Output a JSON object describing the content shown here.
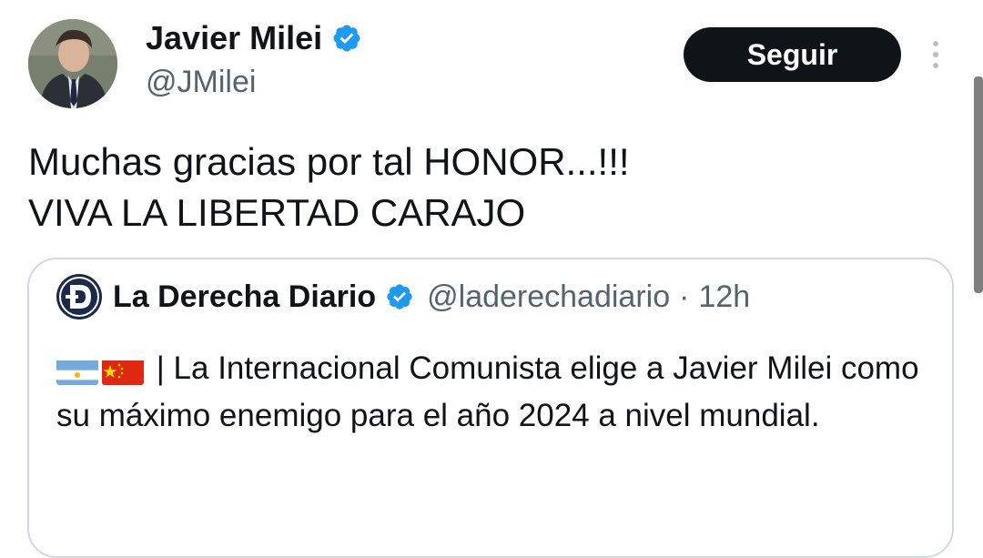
{
  "author": {
    "name": "Javier Milei",
    "handle": "@JMilei",
    "verified_color": "#1d9bf0"
  },
  "actions": {
    "follow_label": "Seguir",
    "more_icon": "more-vertical-icon"
  },
  "tweet": {
    "text": "Muchas gracias por tal HONOR...!!!\nVIVA LA LIBERTAD CARAJO"
  },
  "quote": {
    "author_name": "La Derecha Diario",
    "handle": "@laderechadiario",
    "separator": "·",
    "time": "12h",
    "flags": [
      "argentina-flag-icon",
      "china-flag-icon"
    ],
    "text": " | La Internacional Comunista elige a Javier Milei como su máximo enemigo para el año 2024 a nivel mundial."
  },
  "colors": {
    "text": "#0f1419",
    "secondary": "#536471",
    "border": "#cfd9de",
    "button_bg": "#0f1419",
    "verified": "#1d9bf0"
  }
}
